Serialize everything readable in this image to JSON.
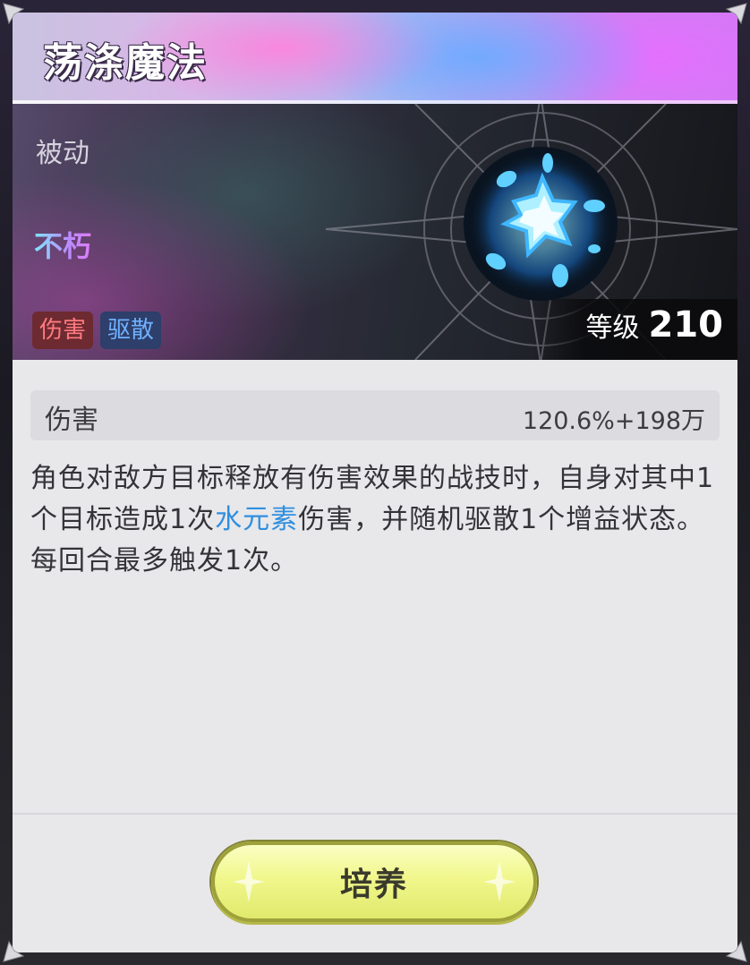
{
  "skill": {
    "title": "荡涤魔法",
    "type": "被动",
    "trait": "不朽",
    "tags": {
      "damage": "伤害",
      "dispel": "驱散"
    },
    "level_label": "等级",
    "level_value": "210"
  },
  "stats": {
    "damage_label": "伤害",
    "damage_value": "120.6%+198万"
  },
  "description": {
    "part1": "角色对敌方目标释放有伤害效果的战技时，自身对其中1个目标造成1次",
    "element": "水元素",
    "part2": "伤害，并随机驱散1个增益状态。每回合最多触发1次。"
  },
  "actions": {
    "cultivate": "培养"
  },
  "colors": {
    "element_highlight": "#2f8fe0",
    "tag_damage": "#ff7a80",
    "tag_dispel": "#6fb0ff",
    "button": "#f1f78c"
  },
  "icons": {
    "skill": "water-splash-icon",
    "corner": "corner-ornament-icon"
  }
}
